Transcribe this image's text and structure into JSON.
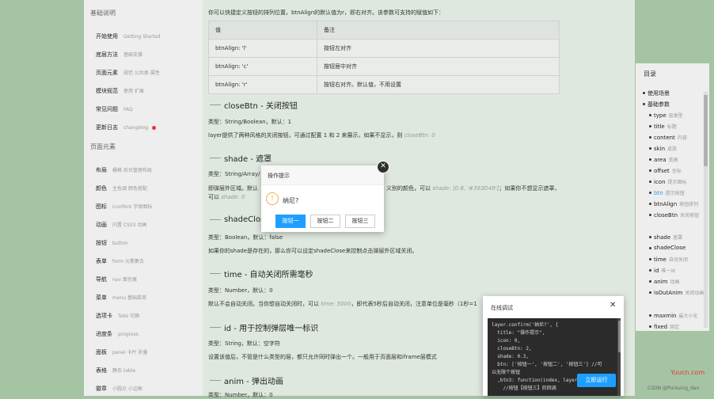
{
  "sidebar": {
    "heads": [
      "基础说明",
      "页面元素"
    ],
    "items": [
      {
        "label": "开始使用",
        "sub": "Getting Started"
      },
      {
        "label": "底层方法",
        "sub": "基础支撑"
      },
      {
        "label": "页面元素",
        "sub": "规范 公共类 属性"
      },
      {
        "label": "模块规范",
        "sub": "使用 扩展"
      },
      {
        "label": "常见问题",
        "sub": "FAQ"
      },
      {
        "label": "更新日志",
        "sub": "changelog"
      },
      {
        "label": "布局",
        "sub": "栅格 后台管理布局"
      },
      {
        "label": "颜色",
        "sub": "主色调 颜色搭配"
      },
      {
        "label": "图标",
        "sub": "iconfont 字体图标"
      },
      {
        "label": "动画",
        "sub": "内置 CSS3 动画"
      },
      {
        "label": "按钮",
        "sub": "button"
      },
      {
        "label": "表单",
        "sub": "form 元素集合"
      },
      {
        "label": "导航",
        "sub": "nav 面包屑"
      },
      {
        "label": "菜单",
        "sub": "menu 基础菜单"
      },
      {
        "label": "选项卡",
        "sub": "Tabs 切换"
      },
      {
        "label": "进度条",
        "sub": "progress"
      },
      {
        "label": "面板",
        "sub": "panel 卡片 折叠"
      },
      {
        "label": "表格",
        "sub": "静态 table"
      },
      {
        "label": "徽章",
        "sub": "小圆点 小边框"
      }
    ]
  },
  "doc": {
    "intro": "你可以快捷定义按钮的排列位置，btnAlign的默认值为r，即右对齐。该参数可支持的赋值如下：",
    "table": {
      "headers": [
        "值",
        "备注"
      ],
      "rows": [
        [
          "btnAlign: 'l'",
          "按钮左对齐"
        ],
        [
          "btnAlign: 'c'",
          "按钮居中对齐"
        ],
        [
          "btnAlign: 'r'",
          "按钮右对齐。默认值，不用设置"
        ]
      ]
    },
    "sections": [
      {
        "title": "closeBtn - 关闭按钮",
        "type": "类型：String/Boolean，默认：1",
        "desc": "layer提供了两种风格的关闭按钮，可通过配置 1 和 2 来展示，如果不显示，则 ",
        "desc_code": "closeBtn: 0"
      },
      {
        "title": "shade - 遮罩",
        "type": "类型：String/Array/",
        "desc": "即弹层外区域。默认",
        "desc_right": "义别的颜色，可以 ",
        "desc_right_code": "shade: [0.8, '#393D49']",
        "desc_right_tail": "；如果你不想显示遮罩，",
        "desc2": "可以 ",
        "desc2_code": "shade: 0"
      },
      {
        "title": "shadeClose",
        "type": "类型：Boolean，默认：false",
        "desc": "如果你的shade是存在的，那么你可以设定shadeClose来控制点击弹层外区域关闭。"
      },
      {
        "title": "time - 自动关闭所需毫秒",
        "type": "类型：Number，默认：0",
        "desc": "默认不会自动关闭。当你想自动关闭时，可以 ",
        "desc_code": "time: 5000",
        "desc_tail": "，即代表5秒后自动关闭，注意单位是毫秒（1秒=1"
      },
      {
        "title": "id - 用于控制弹层唯一标识",
        "type": "类型：String，默认：空字符",
        "desc": "设置该值后，不管是什么类型的层，都只允许同时弹出一个。一般用于页面层和iframe层模式"
      },
      {
        "title": "anim - 弹出动画",
        "type": "类型：Number，默认：0"
      }
    ]
  },
  "dialog": {
    "title": "操作提示",
    "close_glyph": "✕",
    "warn_glyph": "!",
    "message": "纳尼?",
    "buttons": [
      "按钮一",
      "按钮二",
      "按钮三"
    ]
  },
  "toc": {
    "title": "目录",
    "items": [
      {
        "label": "使用场景",
        "sub": "",
        "level": 0
      },
      {
        "label": "基础参数",
        "sub": "",
        "level": 0
      },
      {
        "label": "type",
        "sub": "层类型",
        "level": 1
      },
      {
        "label": "title",
        "sub": "标题",
        "level": 1
      },
      {
        "label": "content",
        "sub": "内容",
        "level": 1
      },
      {
        "label": "skin",
        "sub": "皮肤",
        "level": 1
      },
      {
        "label": "area",
        "sub": "宽高",
        "level": 1
      },
      {
        "label": "offset",
        "sub": "坐标",
        "level": 1
      },
      {
        "label": "icon",
        "sub": "提示图标",
        "level": 1
      },
      {
        "label": "btn",
        "sub": "提示按钮",
        "level": 1,
        "active": true
      },
      {
        "label": "btnAlign",
        "sub": "按钮排列",
        "level": 1
      },
      {
        "label": "closeBtn",
        "sub": "关闭按钮",
        "level": 1
      },
      {
        "label": "shade",
        "sub": "遮罩",
        "level": 1
      },
      {
        "label": "shadeClose",
        "sub": "",
        "level": 1
      },
      {
        "label": "time",
        "sub": "自动关闭",
        "level": 1
      },
      {
        "label": "id",
        "sub": "唯一id",
        "level": 1
      },
      {
        "label": "anim",
        "sub": "动画",
        "level": 1
      },
      {
        "label": "isOutAnim",
        "sub": "关闭动画",
        "level": 1
      },
      {
        "label": "maxmin",
        "sub": "最大小化",
        "level": 1
      },
      {
        "label": "fixed",
        "sub": "固定",
        "level": 1
      }
    ]
  },
  "debug": {
    "title": "在线调试",
    "close_glyph": "✕",
    "code": "layer.confirm('纳尼?', {\n  title: \"操作提示\",\n  icon: 0,\n  closeBtn: 2,\n  shade: 0.3,\n  btn: ['按钮一', '按钮二', '按钮三'] //可\n以无限个按钮\n  ,btn3: function(index, layero){\n    //按钮【按钮三】的回调",
    "run_label": "立即运行"
  },
  "watermark": {
    "brand": "Yuucn.com",
    "credit": "CSDN @Pursuing_dan"
  },
  "colors": {
    "primary": "#1e9fff",
    "background": "#a4c4a4",
    "warn": "#f0ad4e",
    "badge": "#e53935"
  }
}
